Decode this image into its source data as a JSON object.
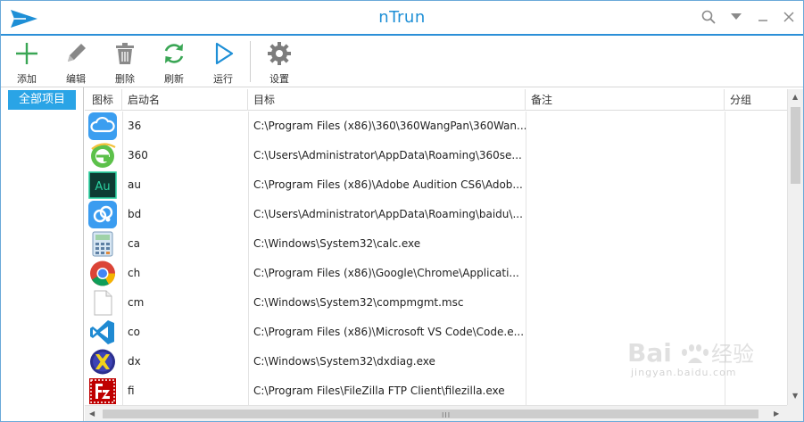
{
  "window": {
    "title": "nTrun",
    "accent_color": "#2b8fd8",
    "title_color": "#1e8fd6"
  },
  "titlebar_controls": [
    {
      "name": "search-icon"
    },
    {
      "name": "dropdown-arrow-icon"
    },
    {
      "name": "minimize-icon"
    },
    {
      "name": "close-icon"
    }
  ],
  "toolbar": {
    "add_label": "添加",
    "edit_label": "编辑",
    "delete_label": "删除",
    "refresh_label": "刷新",
    "run_label": "运行",
    "settings_label": "设置"
  },
  "sidebar": {
    "items": [
      {
        "label": "全部项目",
        "selected": true
      }
    ]
  },
  "table": {
    "columns": {
      "icon": "图标",
      "name": "启动名",
      "target": "目标",
      "note": "备注",
      "group": "分组"
    },
    "rows": [
      {
        "icon": "360-cloud-disk-icon",
        "name": "36",
        "target": "C:\\Program Files (x86)\\360\\360WangPan\\360Wan...",
        "note": "",
        "group": ""
      },
      {
        "icon": "360-browser-icon",
        "name": "360",
        "target": "C:\\Users\\Administrator\\AppData\\Roaming\\360se...",
        "note": "",
        "group": ""
      },
      {
        "icon": "adobe-audition-icon",
        "name": "au",
        "target": "C:\\Program Files (x86)\\Adobe Audition CS6\\Adob...",
        "note": "",
        "group": ""
      },
      {
        "icon": "baidu-netdisk-icon",
        "name": "bd",
        "target": "C:\\Users\\Administrator\\AppData\\Roaming\\baidu\\...",
        "note": "",
        "group": ""
      },
      {
        "icon": "calculator-icon",
        "name": "ca",
        "target": "C:\\Windows\\System32\\calc.exe",
        "note": "",
        "group": ""
      },
      {
        "icon": "chrome-icon",
        "name": "ch",
        "target": "C:\\Program Files (x86)\\Google\\Chrome\\Applicati...",
        "note": "",
        "group": ""
      },
      {
        "icon": "blank-file-icon",
        "name": "cm",
        "target": "C:\\Windows\\System32\\compmgmt.msc",
        "note": "",
        "group": ""
      },
      {
        "icon": "vscode-icon",
        "name": "co",
        "target": "C:\\Program Files (x86)\\Microsoft VS Code\\Code.e...",
        "note": "",
        "group": ""
      },
      {
        "icon": "directx-icon",
        "name": "dx",
        "target": "C:\\Windows\\System32\\dxdiag.exe",
        "note": "",
        "group": ""
      },
      {
        "icon": "filezilla-icon",
        "name": "fi",
        "target": "C:\\Program Files\\FileZilla FTP Client\\filezilla.exe",
        "note": "",
        "group": ""
      }
    ]
  },
  "scroll": {
    "horizontal_grip": "III"
  },
  "watermark": {
    "text": "jingyan.baidu.com"
  }
}
